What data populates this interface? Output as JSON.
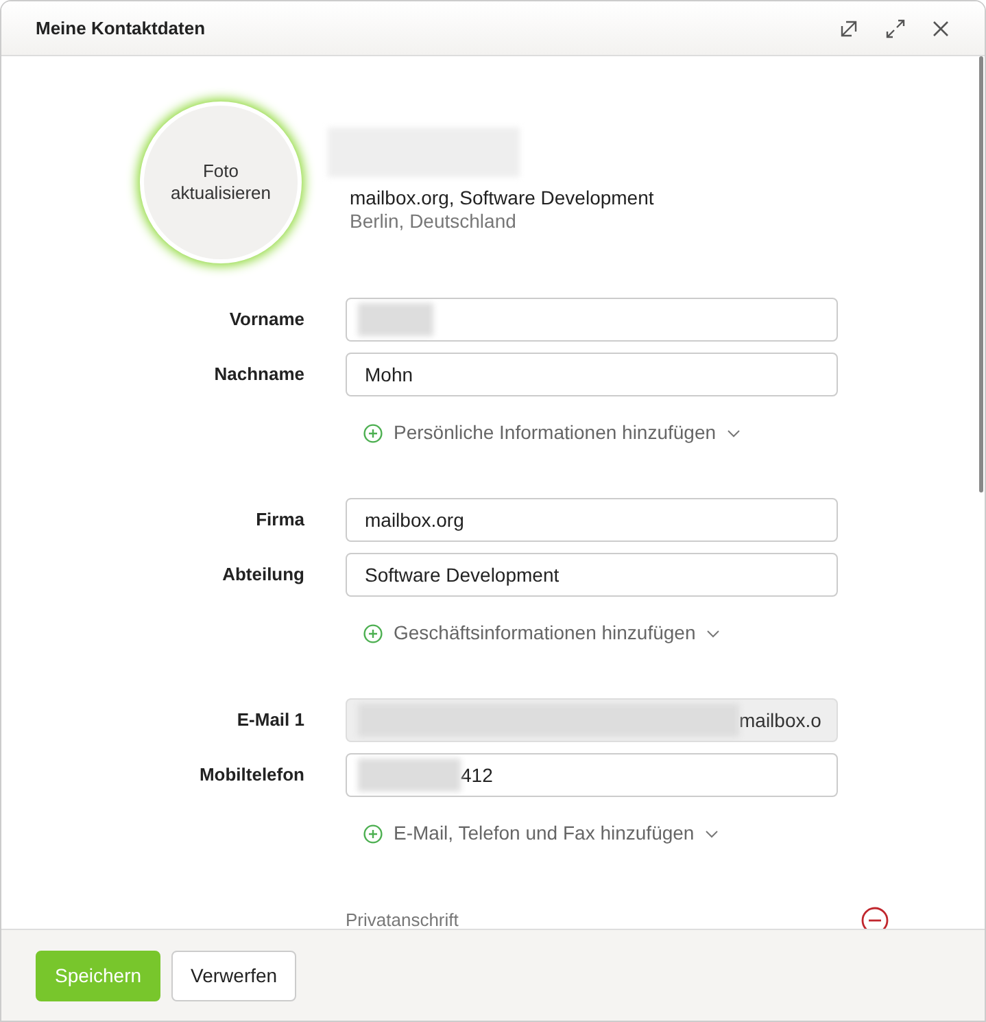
{
  "window": {
    "title": "Meine Kontaktdaten"
  },
  "profile": {
    "photo_button": "Foto aktualisieren",
    "company_line": "mailbox.org, Software Development",
    "location": "Berlin, Deutschland"
  },
  "sections": [
    {
      "fields": [
        {
          "label": "Vorname",
          "kind": "redacted",
          "disabled": false
        },
        {
          "label": "Nachname",
          "kind": "text",
          "value": "Mohn",
          "disabled": false
        }
      ],
      "add_link": "Persönliche Informationen hinzufügen"
    },
    {
      "fields": [
        {
          "label": "Firma",
          "kind": "text",
          "value": "mailbox.org",
          "disabled": false
        },
        {
          "label": "Abteilung",
          "kind": "text",
          "value": "Software Development",
          "disabled": false
        }
      ],
      "add_link": "Geschäftsinformationen hinzufügen"
    },
    {
      "fields": [
        {
          "label": "E-Mail 1",
          "kind": "partly_redacted",
          "value": "mailbox.o",
          "disabled": true
        },
        {
          "label": "Mobiltelefon",
          "kind": "partly_redacted",
          "value": "412",
          "disabled": false
        }
      ],
      "add_link": "E-Mail, Telefon und Fax hinzufügen"
    }
  ],
  "address_section": {
    "title": "Privatanschrift"
  },
  "buttons": [
    {
      "label": "Speichern",
      "kind": "primary"
    },
    {
      "label": "Verwerfen",
      "kind": "secondary"
    }
  ]
}
